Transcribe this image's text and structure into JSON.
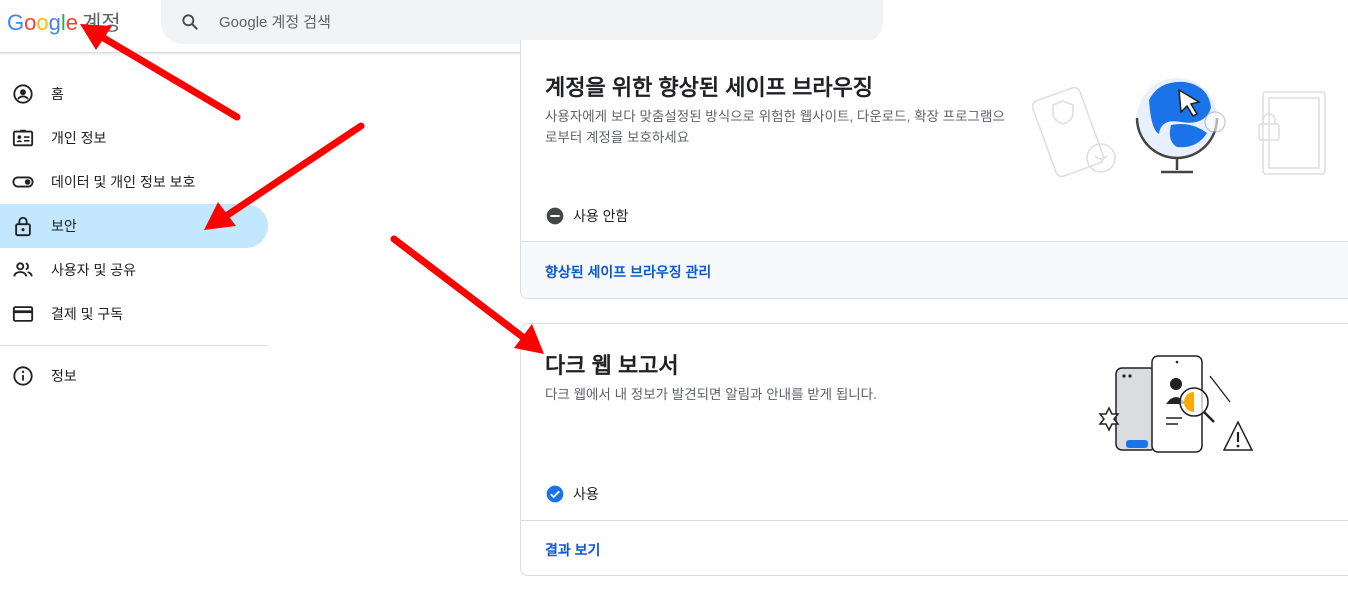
{
  "header": {
    "logo": {
      "G": "G",
      "o1": "o",
      "o2": "o",
      "g": "g",
      "l": "l",
      "e": "e",
      "product": "계정"
    },
    "search": {
      "placeholder": "Google 계정 검색",
      "icon": "search-icon"
    }
  },
  "sidebar": {
    "items": [
      {
        "label": "홈",
        "icon": "account-circle-icon",
        "active": false
      },
      {
        "label": "개인 정보",
        "icon": "id-card-icon",
        "active": false
      },
      {
        "label": "데이터 및 개인 정보 보호",
        "icon": "toggle-icon",
        "active": false
      },
      {
        "label": "보안",
        "icon": "lock-icon",
        "active": true
      },
      {
        "label": "사용자 및 공유",
        "icon": "people-icon",
        "active": false
      },
      {
        "label": "결제 및 구독",
        "icon": "credit-card-icon",
        "active": false
      }
    ],
    "footer_items": [
      {
        "label": "정보",
        "icon": "info-icon"
      }
    ]
  },
  "cards": {
    "safe_browsing": {
      "title": "계정을 위한 향상된 세이프 브라우징",
      "description": "사용자에게 보다 맞춤설정된 방식으로 위험한 웹사이트, 다운로드, 확장 프로그램으로부터 계정을 보호하세요",
      "status": "사용 안함",
      "status_icon": "minus-circle-icon",
      "link": "향상된 세이프 브라우징 관리"
    },
    "dark_web": {
      "title": "다크 웹 보고서",
      "description": "다크 웹에서 내 정보가 발견되면 알림과 안내를 받게 됩니다.",
      "status": "사용",
      "status_icon": "check-circle-icon",
      "link": "결과 보기"
    }
  },
  "colors": {
    "accent_blue": "#0b57d0",
    "active_nav": "#c2e7ff",
    "annotation_arrow": "#ff0000",
    "check_blue": "#1a73e8"
  }
}
